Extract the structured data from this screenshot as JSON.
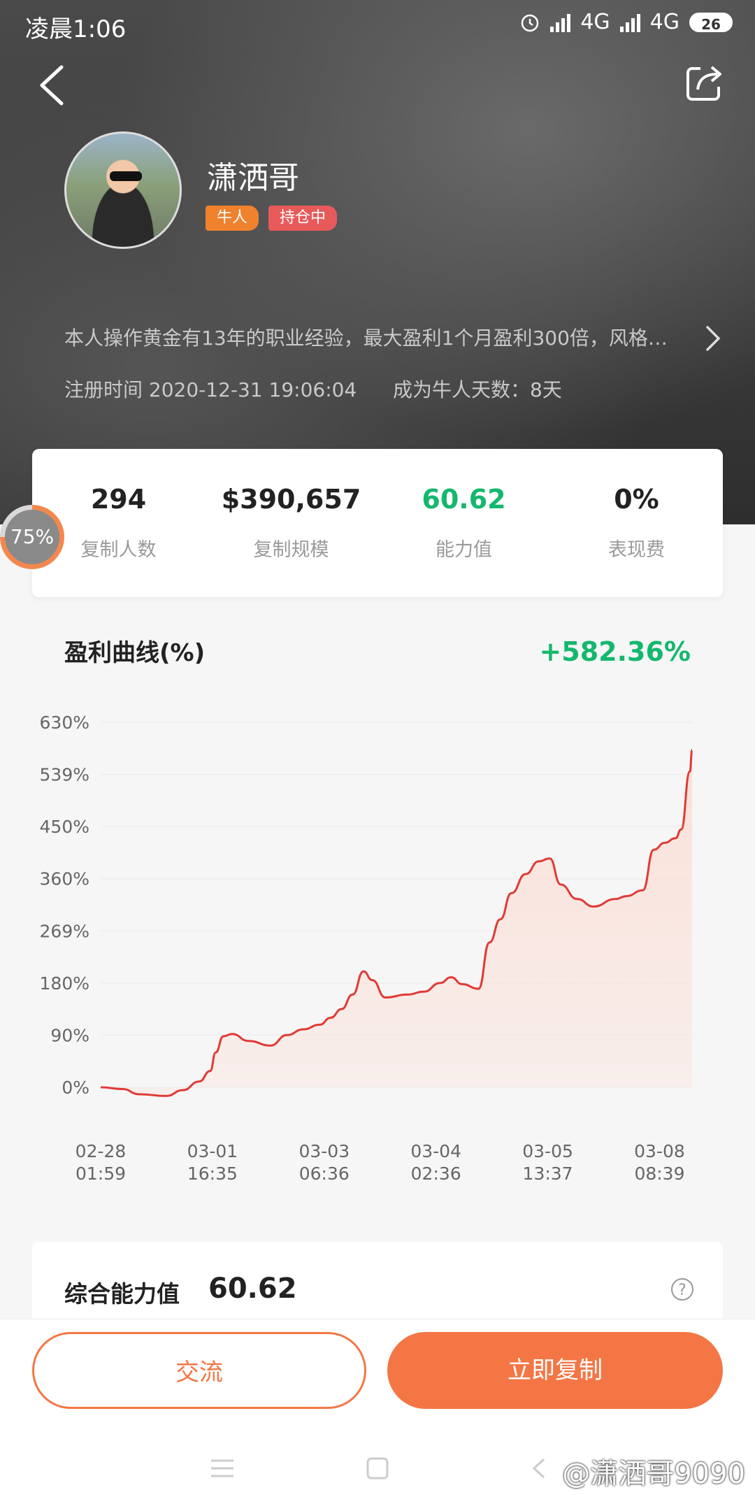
{
  "status_bar": {
    "time": "凌晨1:06",
    "network1": "4G",
    "network2": "4G",
    "battery": "26"
  },
  "profile": {
    "name": "潇洒哥",
    "tags": [
      "牛人",
      "持仓中"
    ],
    "bio": "本人操作黄金有13年的职业经验，最大盈利1个月盈利300倍，风格…",
    "register_time": "注册时间 2020-12-31 19:06:04",
    "days_as_expert": "成为牛人天数：8天"
  },
  "stats": [
    {
      "value": "294",
      "label": "复制人数"
    },
    {
      "value": "$390,657",
      "label": "复制规模"
    },
    {
      "value": "60.62",
      "label": "能力值"
    },
    {
      "value": "0%",
      "label": "表现费"
    }
  ],
  "progress_badge": {
    "text": "75%",
    "value": 0.75
  },
  "chart_section": {
    "title": "盈利曲线(%)",
    "total": "+582.36%"
  },
  "chart_data": {
    "type": "area",
    "ylim": [
      0,
      630
    ],
    "y_ticks": [
      "630%",
      "539%",
      "450%",
      "360%",
      "269%",
      "180%",
      "90%",
      "0%"
    ],
    "x_ticks": [
      {
        "date": "02-28",
        "time": "01:59"
      },
      {
        "date": "03-01",
        "time": "16:35"
      },
      {
        "date": "03-03",
        "time": "06:36"
      },
      {
        "date": "03-04",
        "time": "02:36"
      },
      {
        "date": "03-05",
        "time": "13:37"
      },
      {
        "date": "03-08",
        "time": "08:39"
      }
    ],
    "x_range": [
      0,
      5.4
    ],
    "series": [
      {
        "points": [
          [
            0,
            0
          ],
          [
            0.2,
            -3
          ],
          [
            0.35,
            -12
          ],
          [
            0.6,
            -15
          ],
          [
            0.75,
            -5
          ],
          [
            0.9,
            10
          ],
          [
            1.0,
            28
          ],
          [
            1.05,
            60
          ],
          [
            1.12,
            88
          ],
          [
            1.2,
            92
          ],
          [
            1.35,
            80
          ],
          [
            1.55,
            72
          ],
          [
            1.7,
            90
          ],
          [
            1.85,
            100
          ],
          [
            2.0,
            108
          ],
          [
            2.1,
            120
          ],
          [
            2.2,
            135
          ],
          [
            2.3,
            160
          ],
          [
            2.4,
            200
          ],
          [
            2.48,
            185
          ],
          [
            2.6,
            155
          ],
          [
            2.8,
            160
          ],
          [
            2.95,
            165
          ],
          [
            3.1,
            180
          ],
          [
            3.2,
            190
          ],
          [
            3.3,
            178
          ],
          [
            3.45,
            170
          ],
          [
            3.55,
            250
          ],
          [
            3.65,
            290
          ],
          [
            3.75,
            335
          ],
          [
            3.88,
            368
          ],
          [
            4.0,
            390
          ],
          [
            4.1,
            395
          ],
          [
            4.2,
            350
          ],
          [
            4.35,
            325
          ],
          [
            4.5,
            312
          ],
          [
            4.7,
            325
          ],
          [
            4.8,
            330
          ],
          [
            4.95,
            340
          ],
          [
            5.05,
            410
          ],
          [
            5.15,
            422
          ],
          [
            5.25,
            430
          ],
          [
            5.3,
            445
          ],
          [
            5.38,
            545
          ],
          [
            5.4,
            582
          ]
        ]
      }
    ],
    "colors": {
      "line": "#e03a35",
      "fill": "#fbe0d8"
    }
  },
  "ability_card": {
    "label": "综合能力值",
    "value": "60.62",
    "help": "?"
  },
  "actions": {
    "chat": "交流",
    "copy": "立即复制"
  },
  "watermark": "@潇洒哥9090",
  "colors": {
    "accent": "#f47645",
    "green": "#14b86d"
  }
}
